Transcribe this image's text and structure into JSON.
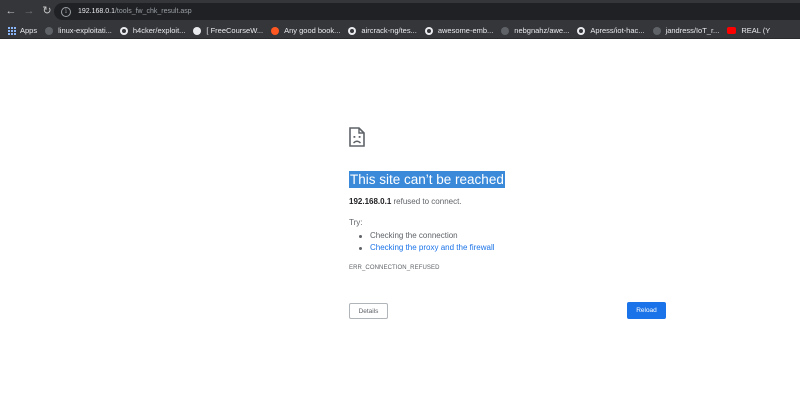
{
  "browser": {
    "url_host": "192.168.0.1",
    "url_path": "/tools_fw_chk_result.asp"
  },
  "bookmarks": [
    {
      "label": "Apps",
      "icon": "apps-icon"
    },
    {
      "label": "linux-exploitati...",
      "icon": "globe-icon"
    },
    {
      "label": "h4cker/exploit...",
      "icon": "github-icon"
    },
    {
      "label": "[ FreeCourseW...",
      "icon": "freecourseweb-icon"
    },
    {
      "label": "Any good book...",
      "icon": "reddit-icon"
    },
    {
      "label": "aircrack-ng/tes...",
      "icon": "github-icon"
    },
    {
      "label": "awesome-emb...",
      "icon": "github-icon"
    },
    {
      "label": "nebgnahz/awe...",
      "icon": "globe-icon"
    },
    {
      "label": "Apress/iot-hac...",
      "icon": "github-icon"
    },
    {
      "label": "jandress/IoT_r...",
      "icon": "globe-icon"
    },
    {
      "label": "REAL (Y",
      "icon": "youtube-icon"
    }
  ],
  "error": {
    "heading": "This site can’t be reached",
    "host": "192.168.0.1",
    "message": "refused to connect.",
    "try_label": "Try:",
    "suggestions": [
      "Checking the connection",
      "Checking the proxy and the firewall"
    ],
    "code": "ERR_CONNECTION_REFUSED",
    "details_label": "Details",
    "reload_label": "Reload"
  },
  "colors": {
    "chrome_bg": "#35363a",
    "omnibox_bg": "#202124",
    "selection": "#3b8ad9",
    "link": "#1a73e8",
    "button_primary": "#1a73e8"
  }
}
